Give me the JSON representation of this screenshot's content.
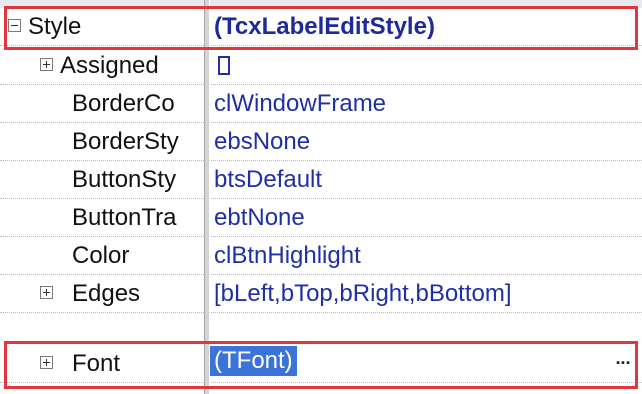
{
  "properties": [
    {
      "name": "Style",
      "value": "(TcxLabelEditStyle)",
      "expander": "minus",
      "value_bold": true
    },
    {
      "name": "Assigned",
      "value": "",
      "expander": "plus"
    },
    {
      "name": "BorderCo",
      "value": "clWindowFrame"
    },
    {
      "name": "BorderSty",
      "value": "ebsNone"
    },
    {
      "name": "ButtonSty",
      "value": "btsDefault"
    },
    {
      "name": "ButtonTra",
      "value": "ebtNone"
    },
    {
      "name": "Color",
      "value": "clBtnHighlight"
    },
    {
      "name": "Edges",
      "value": "[bLeft,bTop,bRight,bBottom]",
      "expander": "plus"
    },
    {
      "name": "Font",
      "value": "(TFont)",
      "expander": "plus",
      "selected": true,
      "button": "..."
    }
  ],
  "colors": {
    "value_text": "#1f2fa6",
    "highlight_border": "#e1363c",
    "selection": "#3b73d6"
  }
}
